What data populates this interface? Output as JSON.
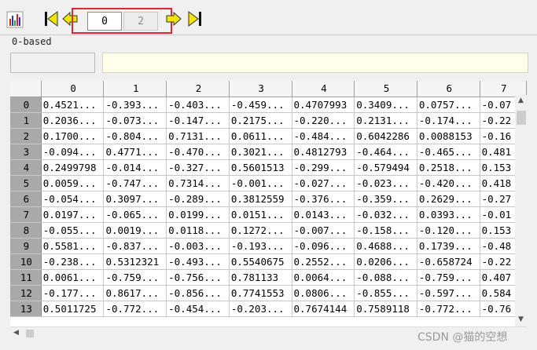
{
  "toolbar": {
    "chart_icon": "bar-chart-icon",
    "first_icon": "first-page-icon",
    "prev_icon": "prev-page-icon",
    "next_icon": "next-page-icon",
    "last_icon": "last-page-icon",
    "current_page": "0",
    "total_pages": "2",
    "arrow_color": "#f2e600"
  },
  "index_mode": "0-based",
  "grid": {
    "columns": [
      "0",
      "1",
      "2",
      "3",
      "4",
      "5",
      "6",
      "7"
    ],
    "rows": [
      {
        "label": "0",
        "cells": [
          "0.4521...",
          "-0.393...",
          "-0.403...",
          "-0.459...",
          "0.4707993",
          "0.3409...",
          "0.0757...",
          "-0.07"
        ]
      },
      {
        "label": "1",
        "cells": [
          "0.2036...",
          "-0.073...",
          "-0.147...",
          "0.2175...",
          "-0.220...",
          "0.2131...",
          "-0.174...",
          "-0.22"
        ]
      },
      {
        "label": "2",
        "cells": [
          "0.1700...",
          "-0.804...",
          "0.7131...",
          "0.0611...",
          "-0.484...",
          "0.6042286",
          "0.0088153",
          "-0.16"
        ]
      },
      {
        "label": "3",
        "cells": [
          "-0.094...",
          "0.4771...",
          "-0.470...",
          "0.3021...",
          "0.4812793",
          "-0.464...",
          "-0.465...",
          "0.481"
        ]
      },
      {
        "label": "4",
        "cells": [
          "0.2499798",
          "-0.014...",
          "-0.327...",
          "0.5601513",
          "-0.299...",
          "-0.579494",
          "0.2518...",
          "0.153"
        ]
      },
      {
        "label": "5",
        "cells": [
          "0.0059...",
          "-0.747...",
          "0.7314...",
          "-0.001...",
          "-0.027...",
          "-0.023...",
          "-0.420...",
          "0.418"
        ]
      },
      {
        "label": "6",
        "cells": [
          "-0.054...",
          "0.3097...",
          "-0.289...",
          "0.3812559",
          "-0.376...",
          "-0.359...",
          "0.2629...",
          "-0.27"
        ]
      },
      {
        "label": "7",
        "cells": [
          "0.0197...",
          "-0.065...",
          "0.0199...",
          "0.0151...",
          "0.0143...",
          "-0.032...",
          "0.0393...",
          "-0.01"
        ]
      },
      {
        "label": "8",
        "cells": [
          "-0.055...",
          "0.0019...",
          "0.0118...",
          "0.1272...",
          "-0.007...",
          "-0.158...",
          "-0.120...",
          "0.153"
        ]
      },
      {
        "label": "9",
        "cells": [
          "0.5581...",
          "-0.837...",
          "-0.003...",
          "-0.193...",
          "-0.096...",
          "0.4688...",
          "0.1739...",
          "-0.48"
        ]
      },
      {
        "label": "10",
        "cells": [
          "-0.238...",
          "0.5312321",
          "-0.493...",
          "0.5540675",
          "0.2552...",
          "0.0206...",
          "-0.658724",
          "-0.22"
        ]
      },
      {
        "label": "11",
        "cells": [
          "0.0061...",
          "-0.759...",
          "-0.756...",
          "0.781133",
          "0.0064...",
          "-0.088...",
          "-0.759...",
          "0.407"
        ]
      },
      {
        "label": "12",
        "cells": [
          "-0.177...",
          "0.8617...",
          "-0.856...",
          "0.7741553",
          "0.0806...",
          "-0.855...",
          "-0.597...",
          "0.584"
        ]
      },
      {
        "label": "13",
        "cells": [
          "0.5011725",
          "-0.772...",
          "-0.454...",
          "-0.203...",
          "0.7674144",
          "0.7589118",
          "-0.772...",
          "-0.76"
        ]
      }
    ]
  },
  "watermark": "CSDN @猫的空想"
}
